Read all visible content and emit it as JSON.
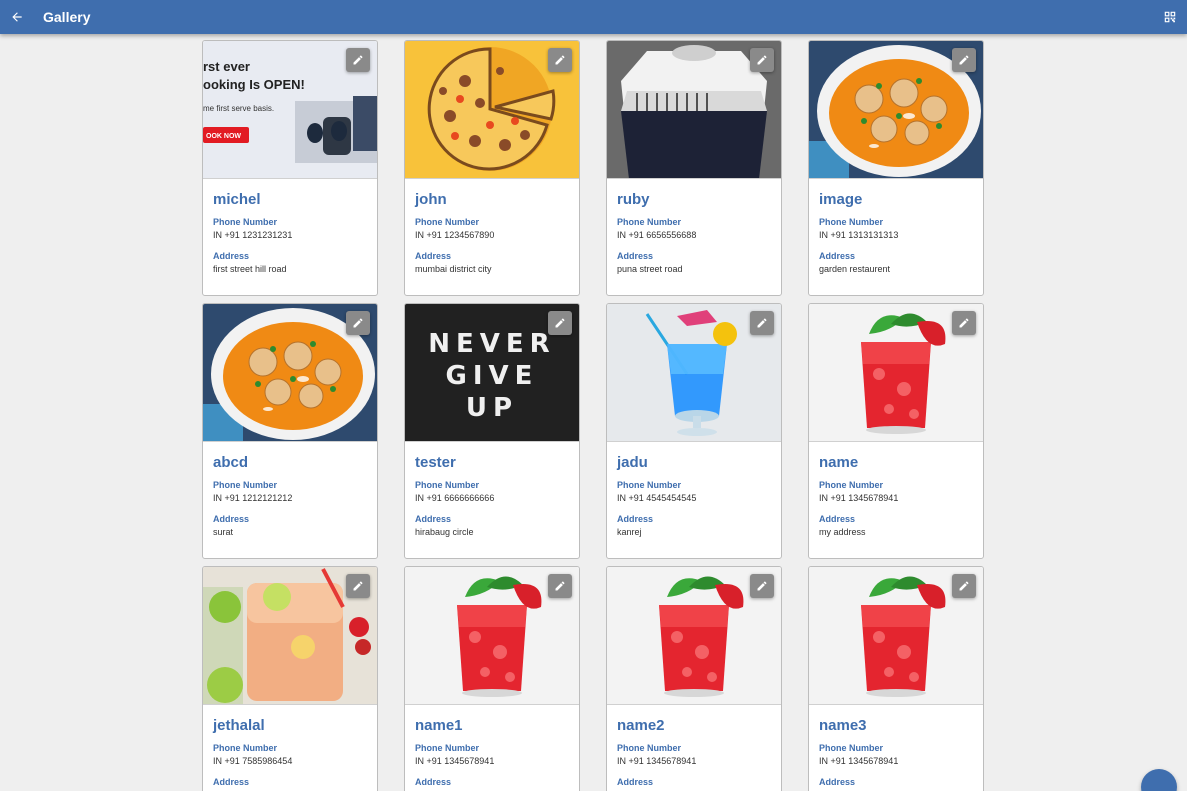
{
  "header": {
    "title": "Gallery",
    "back_icon": "arrow-left-icon",
    "action_icon": "qr-code-add-icon"
  },
  "labels": {
    "phone": "Phone Number",
    "address": "Address"
  },
  "colors": {
    "primary": "#3f6eae",
    "background": "#efefef",
    "edit_button": "#8a8a8a"
  },
  "cards": [
    {
      "name": "michel",
      "phone": "IN +91 1231231231",
      "address": "first street hill road",
      "image": "promo-banner",
      "banner_lines": [
        "rst ever",
        "ooking Is OPEN!",
        "me first serve basis."
      ],
      "banner_button": "OOK NOW"
    },
    {
      "name": "john",
      "phone": "IN +91 1234567890",
      "address": "mumbai district city",
      "image": "pizza"
    },
    {
      "name": "ruby",
      "phone": "IN +91 6656556688",
      "address": "puna street road",
      "image": "sweatshirt"
    },
    {
      "name": "image",
      "phone": "IN +91 1313131313",
      "address": "garden restaurent",
      "image": "curry-bowl"
    },
    {
      "name": "abcd",
      "phone": "IN +91 1212121212",
      "address": "surat",
      "image": "curry-bowl"
    },
    {
      "name": "tester",
      "phone": "IN +91 6666666666",
      "address": "hirabaug circle",
      "image": "never-give-up",
      "poster_lines": [
        "NEVER",
        "GIVE",
        "UP"
      ]
    },
    {
      "name": "jadu",
      "phone": "IN +91 4545454545",
      "address": "kanrej",
      "image": "blue-drink"
    },
    {
      "name": "name",
      "phone": "IN +91 1345678941",
      "address": "my address",
      "image": "red-drink"
    },
    {
      "name": "jethalal",
      "phone": "IN +91 7585986454",
      "address": "",
      "image": "lemonade-jar"
    },
    {
      "name": "name1",
      "phone": "IN +91 1345678941",
      "address": "",
      "image": "red-drink"
    },
    {
      "name": "name2",
      "phone": "IN +91 1345678941",
      "address": "",
      "image": "red-drink"
    },
    {
      "name": "name3",
      "phone": "IN +91 1345678941",
      "address": "",
      "image": "red-drink"
    }
  ]
}
